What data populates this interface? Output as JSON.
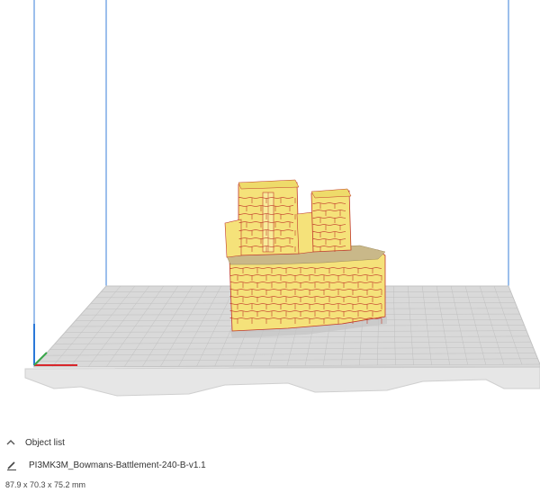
{
  "viewport": {
    "model_color": "#f5e27a",
    "model_edge_color": "#c0392b",
    "plate_color": "#d9d9d9",
    "grid_color": "#bfbfbf",
    "axis_x_color": "#d8262b",
    "axis_y_color": "#3aa64a",
    "axis_z_color": "#2a78d8",
    "build_volume_edge_color": "#3a7fd8"
  },
  "object_list": {
    "toggle_label": "Object list",
    "toggle_icon": "chevron-up-icon",
    "item_icon": "pencil-icon",
    "item_name": "PI3MK3M_Bowmans-Battlement-240-B-v1.1",
    "dimensions": "87.9 x 70.3 x 75.2 mm"
  }
}
